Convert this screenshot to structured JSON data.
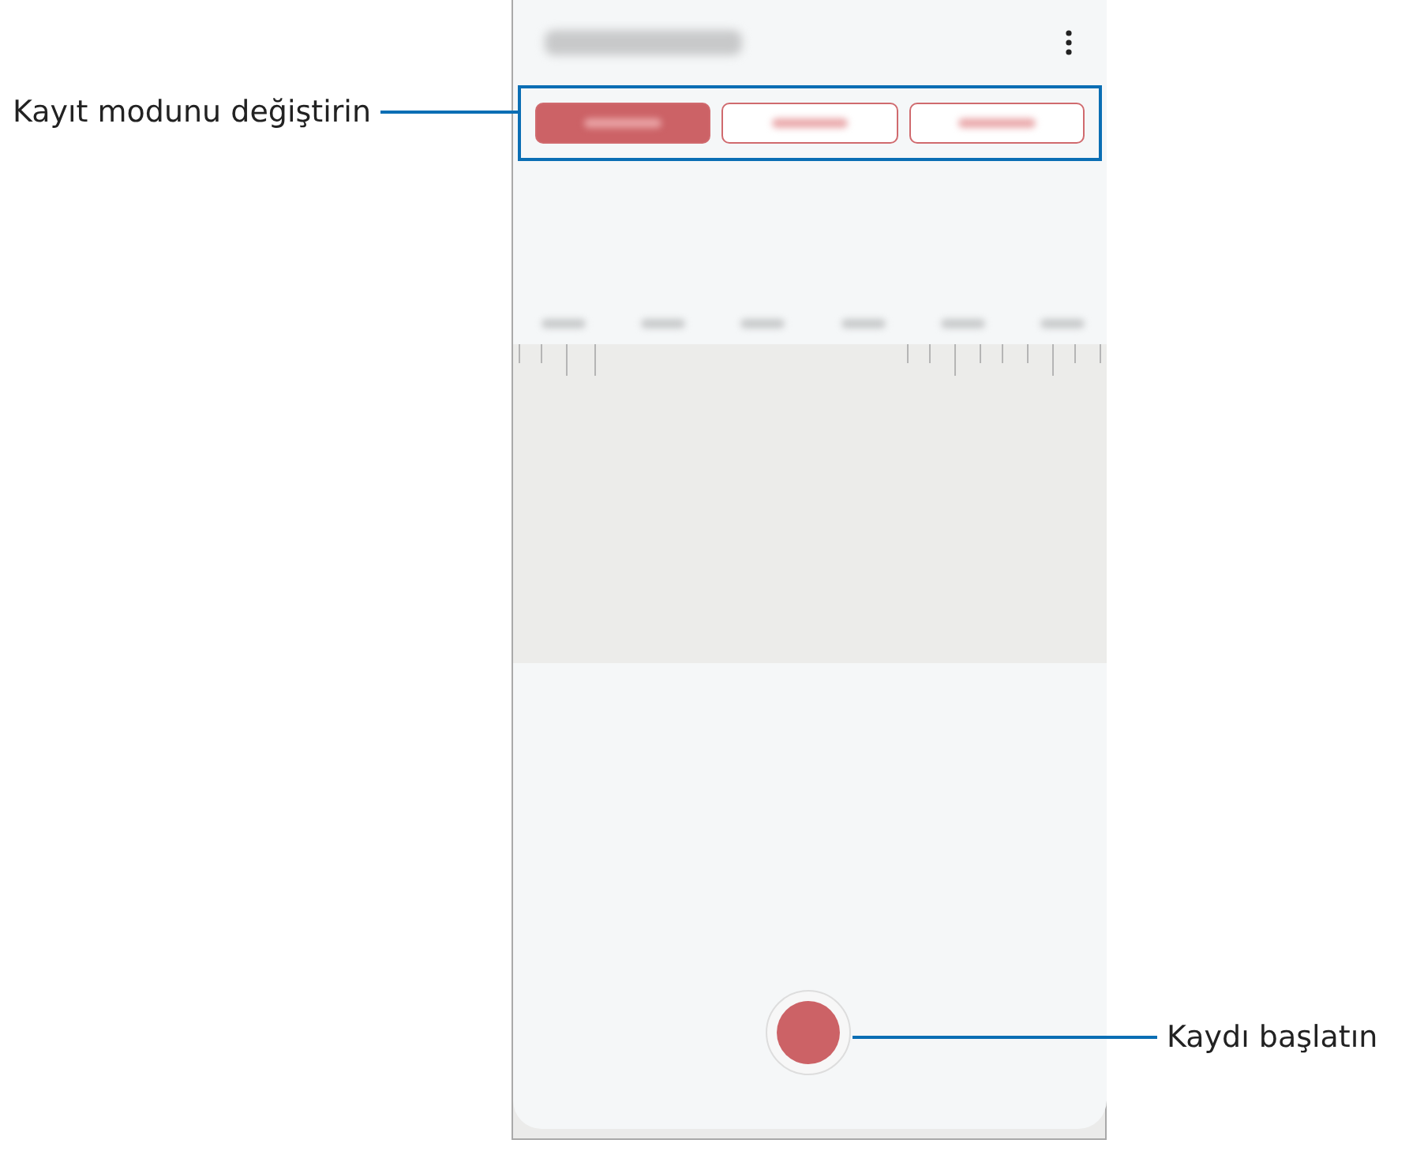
{
  "callouts": [
    {
      "text": "Kayıt modunu değiştirin",
      "kind": "left"
    },
    {
      "text": "Kaydı başlatın",
      "kind": "right"
    }
  ],
  "modes": [
    {
      "selected": true
    },
    {
      "selected": false
    },
    {
      "selected": false
    }
  ]
}
